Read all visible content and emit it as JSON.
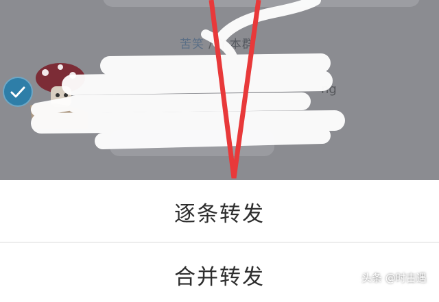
{
  "chat": {
    "system_tip": {
      "part1": "苦笑",
      "sep": "/",
      "part2": "丫本群"
    },
    "partial_text": "ng"
  },
  "action_sheet": {
    "option1": "逐条转发",
    "option2": "合并转发"
  },
  "watermark": "头条 @时古遇",
  "colors": {
    "overlay": "#8b8c91",
    "check": "#2e7ea8",
    "annotation": "#e8393a"
  }
}
